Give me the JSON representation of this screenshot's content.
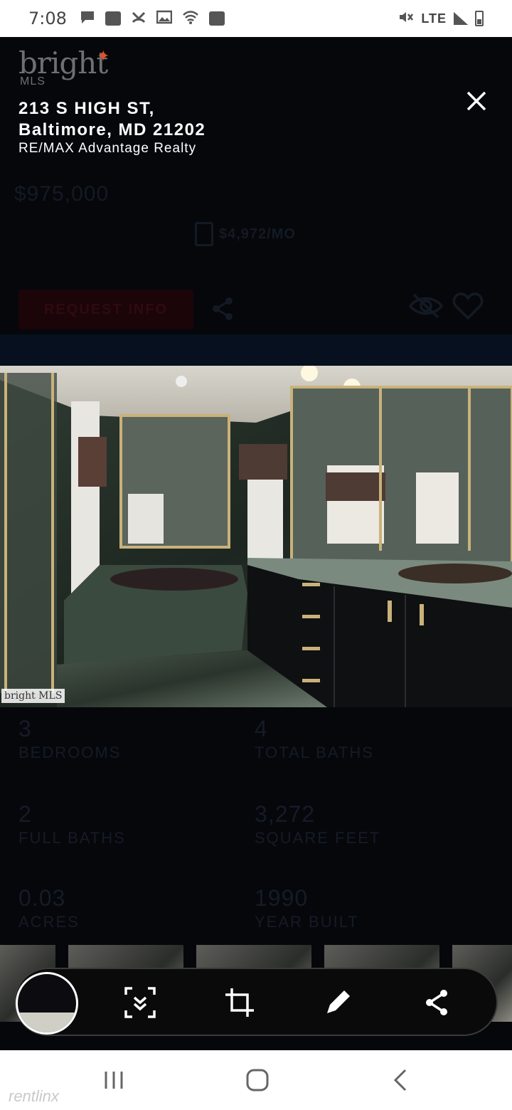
{
  "status_bar": {
    "time": "7:08",
    "network": "LTE",
    "icons": [
      "chat-icon",
      "square-icon",
      "missed-call-icon",
      "image-icon",
      "wifi-icon",
      "notification-icon"
    ]
  },
  "brand": {
    "name": "bright",
    "sub": "MLS"
  },
  "listing": {
    "address_line1": "213 S HIGH ST,",
    "address_line2": "Baltimore, MD 21202",
    "agency": "RE/MAX Advantage Realty",
    "price": "$975,000",
    "monthly": "$4,972/MO",
    "request_label": "REQUEST INFO"
  },
  "photo": {
    "watermark": "bright MLS"
  },
  "stats": [
    {
      "value": "3",
      "label": "BEDROOMS"
    },
    {
      "value": "4",
      "label": "TOTAL BATHS"
    },
    {
      "value": "2",
      "label": "FULL BATHS"
    },
    {
      "value": "3,272",
      "label": "SQUARE FEET"
    },
    {
      "value": "0.03",
      "label": "ACRES"
    },
    {
      "value": "1990",
      "label": "YEAR BUILT"
    }
  ],
  "toolbar": {
    "tools": [
      "scroll-capture-icon",
      "crop-icon",
      "edit-icon",
      "share-icon"
    ]
  },
  "footer": {
    "watermark": "rentlinx"
  },
  "colors": {
    "accent_red": "#e1502b",
    "background": "#05070b"
  }
}
